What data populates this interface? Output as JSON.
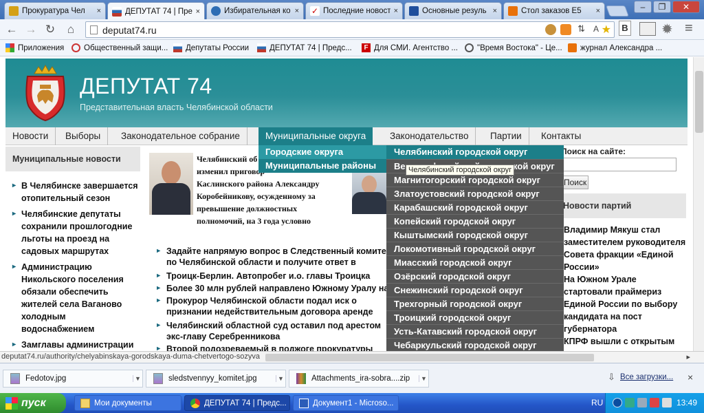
{
  "browser": {
    "tabs": [
      {
        "title": "Прокуратура Чел",
        "favicon_color": "#d4a017"
      },
      {
        "title": "ДЕПУТАТ 74 | Пре",
        "favicon_color": "#c0392b",
        "active": true
      },
      {
        "title": "Избирательная ко",
        "favicon_color": "#2e6db4"
      },
      {
        "title": "Последние новост",
        "favicon_color": "#cc0000"
      },
      {
        "title": "Основные резуль",
        "favicon_color": "#1f4e9c"
      },
      {
        "title": "Стол заказов E5",
        "favicon_color": "#e8710a"
      }
    ],
    "tab_close": "×",
    "url": "deputat74.ru",
    "bookmarks": [
      {
        "label": "Приложения",
        "color": "#c33"
      },
      {
        "label": "Общественный защи...",
        "color": "#c33"
      },
      {
        "label": "Депутаты России",
        "color": "#2e6db4"
      },
      {
        "label": "ДЕПУТАТ 74 | Предс...",
        "color": "#2e6db4"
      },
      {
        "label": "Для СМИ. Агентство ...",
        "color": "#cc0000"
      },
      {
        "label": "\"Время Востока\" - Це...",
        "color": "#555"
      },
      {
        "label": "журнал Александра ...",
        "color": "#e8710a"
      }
    ]
  },
  "site": {
    "title": "ДЕПУТАТ 74",
    "subtitle": "Представительная власть Челябинской области",
    "menu": [
      "Новости",
      "Выборы",
      "Законодательное собрание",
      "Муниципальные округа",
      "Законодательство",
      "Партии",
      "Контакты"
    ],
    "submenu_level1": [
      "Городские округа",
      "Муниципальные районы"
    ],
    "submenu_level2": [
      "Челябинский городской округ",
      "Верхнеуфалейский городской округ",
      "Магнитогорский городской округ",
      "Златоустовский городской округ",
      "Карабашский городской округ",
      "Копейский городской округ",
      "Кыштымский городской округ",
      "Локомотивный городской округ",
      "Миасский городской округ",
      "Озёрский городской округ",
      "Снежинский городской округ",
      "Трехгорный городской округ",
      "Троицкий городской округ",
      "Усть-Катавский городской округ",
      "Чебаркульский городской округ"
    ],
    "tooltip": "Челябинский городской округ",
    "left": {
      "heading": "Муниципальные новости",
      "items": [
        "В Челябинске завершается отопительный сезон",
        "Челябинские депутаты сохранили прошлогодние льготы на проезд на садовых маршрутах",
        "Администрацию Никольского поселения обязали обеспечить жителей села Ваганово холодным водоснабжением",
        "Замглавы администрации"
      ]
    },
    "featured": {
      "lines": [
        "Челябинский об",
        "изменил приговор",
        "Каслинского района Александру",
        "Коробейникову, осужденному за",
        "превышение должностных",
        "полномочий, на 3 года условно"
      ]
    },
    "news": [
      "Задайте напрямую вопрос в Следственный комитет по Челябинской области и получите ответ в течение года",
      "Троицк-Берлин. Автопробег и.о. главы Троицка студентов",
      "Более 30 млн рублей направлено Южному Уралу на ра",
      "Прокурор Челябинской области подал иск о признании недействительным договора аренде земельного участка под городскую свалку",
      "Челябинский областной суд оставил под арестом экс-главу Серебренникова",
      "Второй подозреваемый в поджоге прокуратуры Калин"
    ],
    "right": {
      "search_label": "Поиск на сайте:",
      "search_placeholder": "",
      "search_button": "Поиск",
      "parties_heading": "Новости партий",
      "party_items": [
        "Владимир Мякуш стал заместителем руководителя Совета фракции «Единой России»",
        "На Южном Урале стартовали праймериз Единой России по выбору кандидата на пост губернатора",
        "КПРФ вышли с открытым письмом к руководству Южного Урала и"
      ]
    }
  },
  "status": {
    "url": "deputat74.ru/authority/chelyabinskaya-gorodskaya-duma-chetvertogo-sozyva"
  },
  "downloads": {
    "items": [
      "Fedotov.jpg",
      "sledstvennyy_komitet.jpg",
      "Attachments_ira-sobra....zip"
    ],
    "all_label": "Все загрузки...",
    "close": "×"
  },
  "taskbar": {
    "start": "пуск",
    "items": [
      "Мои документы",
      "ДЕПУТАТ 74 | Предс...",
      "Документ1 - Microso..."
    ],
    "lang": "RU",
    "clock": "13:49"
  },
  "colors": {
    "header_teal": "#1f8c93",
    "menu_active": "#1c7f89",
    "submenu_dark": "#555555",
    "taskbar_blue": "#2456c8"
  }
}
